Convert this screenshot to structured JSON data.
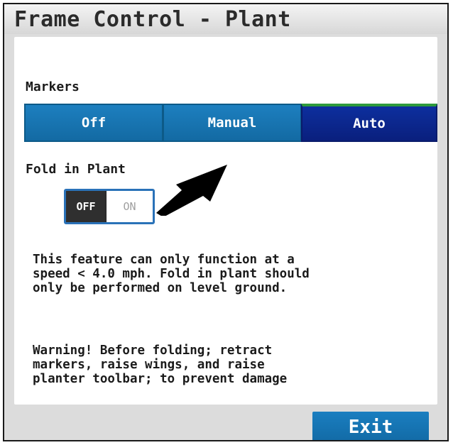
{
  "window": {
    "title": "Frame Control - Plant"
  },
  "markers": {
    "label": "Markers",
    "options": [
      "Off",
      "Manual",
      "Auto"
    ],
    "selected": "Auto"
  },
  "fold_in_plant": {
    "label": "Fold in Plant",
    "off_label": "OFF",
    "on_label": "ON",
    "state": "OFF"
  },
  "info_text": {
    "line1": "This feature can only function at a",
    "line2": "speed < 4.0 mph. Fold in plant should",
    "line3": "only be performed on level ground."
  },
  "warning_text": {
    "line1": "Warning! Before folding; retract",
    "line2": "markers, raise wings, and raise",
    "line3": "planter toolbar; to prevent damage"
  },
  "footer": {
    "exit_label": "Exit"
  },
  "colors": {
    "segment_blue": "#1d7fbf",
    "segment_selected": "#0a1f7d",
    "selected_indicator": "#2e9a3c",
    "toggle_off_bg": "#2f2f2f",
    "toggle_border": "#2a72b8"
  }
}
